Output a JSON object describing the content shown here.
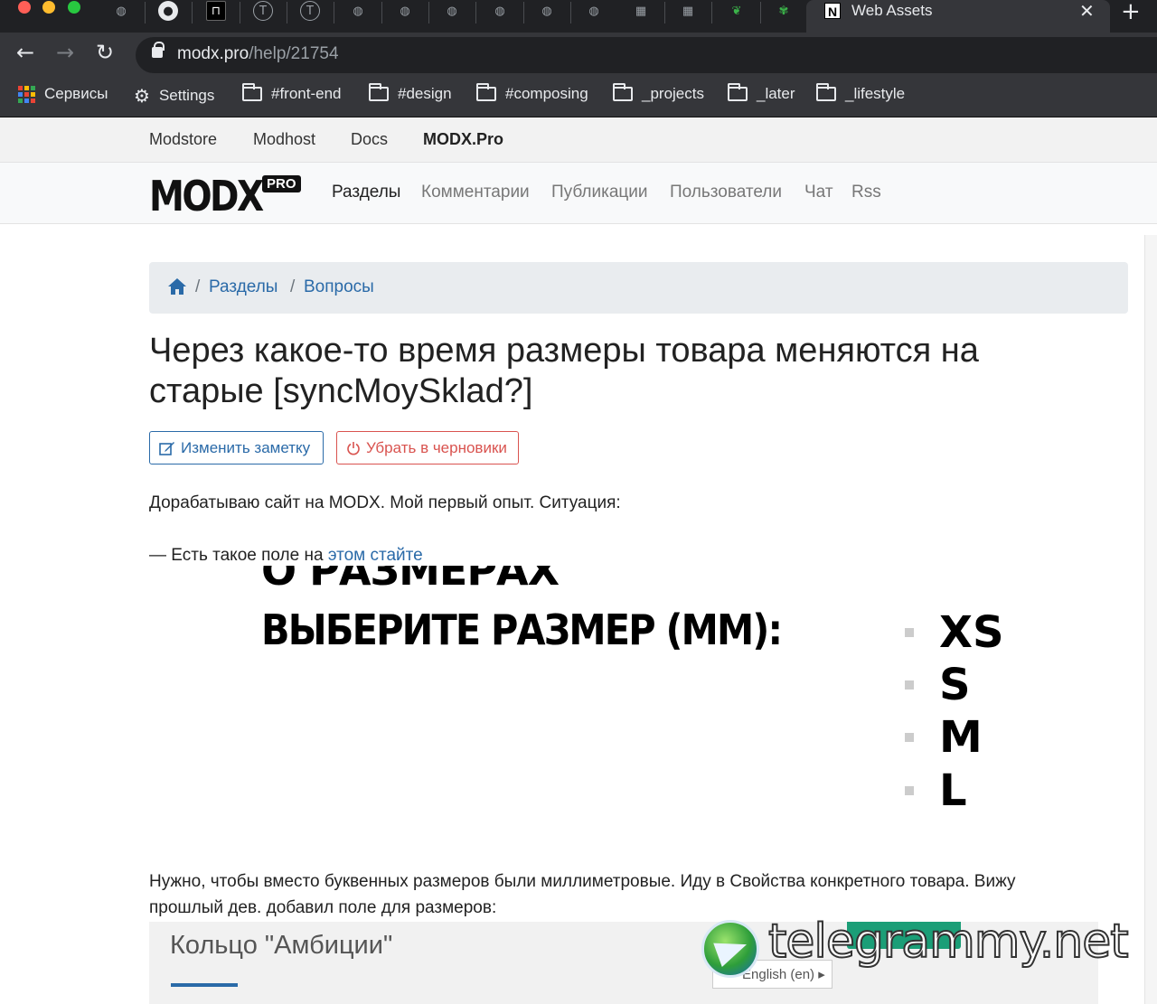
{
  "browser": {
    "active_tab_title": "Web Assets",
    "active_tab_favicon": "N",
    "url_host": "modx.pro",
    "url_path": "/help/21754",
    "bookmarks": [
      "Сервисы",
      "Settings",
      "#front-end",
      "#design",
      "#composing",
      "_projects",
      "_later",
      "_lifestyle"
    ]
  },
  "site": {
    "top_links": [
      "Modstore",
      "Modhost",
      "Docs",
      "MODX.Pro"
    ],
    "logo_text": "MODX",
    "logo_badge": "PRO",
    "main_links": [
      "Разделы",
      "Комментарии",
      "Публикации",
      "Пользователи",
      "Чат",
      "Rss"
    ]
  },
  "breadcrumb": [
    "Разделы",
    "Вопросы"
  ],
  "article": {
    "title": "Через какое-то время размеры товара меняются на старые [syncMoySklad?]",
    "edit_button": "Изменить заметку",
    "draft_button": "Убрать в черновики",
    "para1": "Дорабатываю сайт на MODX. Мой первый опыт. Ситуация:",
    "para2_prefix": "— Есть такое поле на ",
    "para2_link": "этом стайте",
    "image": {
      "cut_text": "О РАЗМЕРАХ",
      "heading": "ВЫБЕРИТЕ РАЗМЕР (ММ):",
      "sizes": [
        "XS",
        "S",
        "M",
        "L"
      ]
    },
    "para3": "Нужно, чтобы вместо буквенных размеров были миллиметровые. Иду в Свойства конкретного товара. Вижу прошлый дев. добавил поле для размеров:"
  },
  "admin_shot": {
    "product_title": "Кольцо \"Амбиции\"",
    "lang": "English (en)"
  },
  "watermark": "telegrammy.net",
  "colors": {
    "link": "#2a6aa8",
    "danger": "#d9534f",
    "chrome_dark": "#202124",
    "chrome_toolbar": "#35363a"
  }
}
